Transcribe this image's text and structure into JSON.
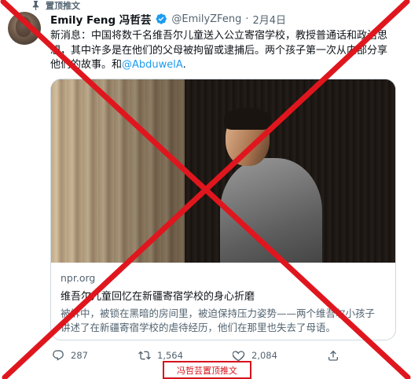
{
  "pinned": {
    "label": "置顶推文"
  },
  "author": {
    "name": "Emily Feng 冯哲芸",
    "handle": "@EmilyZFeng",
    "separator": "·",
    "date": "2月4日"
  },
  "tweet": {
    "line1": "新消息：中国将数千名维吾尔儿童送入公立寄宿学校，教授普通话和政治思",
    "line2": "想，其中许多是在他们的父母被拘留或逮捕后。两个孩子第一次从内部分享",
    "line3_prefix": "他们的故事。和",
    "mention": "@AbduwelA",
    "line3_suffix": "."
  },
  "card": {
    "domain": "npr.org",
    "title": "维吾尔儿童回忆在新疆寄宿学校的身心折磨",
    "desc_line1": "被拆中，被锁在黑暗的房间里，被迫保持压力姿势——两个维吾尔小孩子",
    "desc_line2": "讲述了在新疆寄宿学校的虐待经历，他们在那里也失去了母语。"
  },
  "actions": {
    "replies": "287",
    "retweets": "1,564",
    "likes": "2,084"
  },
  "overlay": {
    "caption": "冯哲芸置顶推文",
    "cross_color": "#e0161e"
  },
  "colors": {
    "accent": "#1d9bf0",
    "text": "#0f1419",
    "muted": "#536471",
    "cross": "#e0161e"
  }
}
